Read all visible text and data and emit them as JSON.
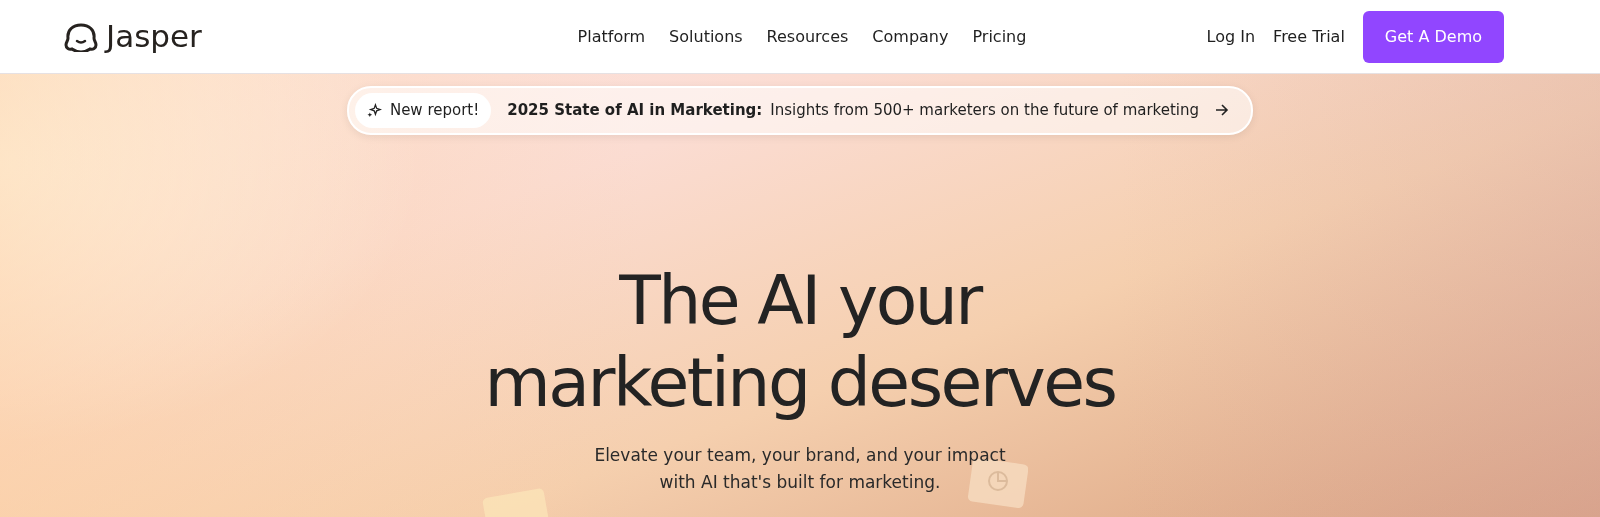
{
  "header": {
    "logo": "Jasper",
    "nav": [
      "Platform",
      "Solutions",
      "Resources",
      "Company",
      "Pricing"
    ],
    "links": [
      "Log In",
      "Free Trial"
    ],
    "cta": "Get A Demo"
  },
  "announcement": {
    "badge": "New report!",
    "title": "2025 State of AI in Marketing:",
    "text": "Insights from 500+ marketers on the future of marketing"
  },
  "hero": {
    "headline_lines": [
      "The AI your",
      "marketing deserves"
    ],
    "subtitle_lines": [
      "Elevate your team, your brand, and your impact",
      "with AI that's built for marketing."
    ]
  }
}
